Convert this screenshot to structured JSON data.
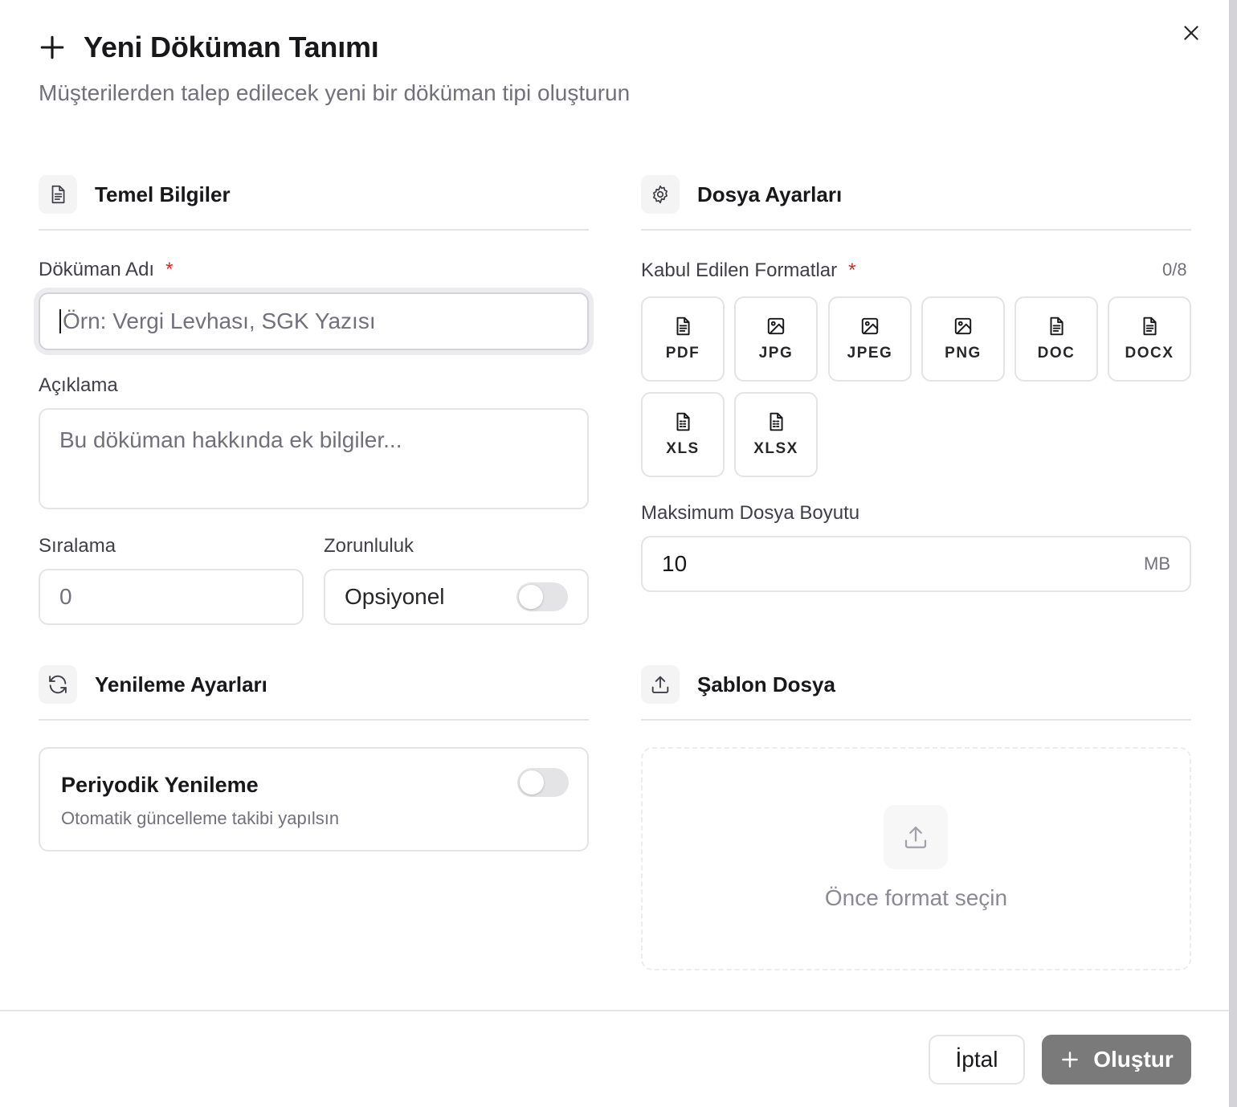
{
  "header": {
    "title": "Yeni Döküman Tanımı",
    "subtitle": "Müşterilerden talep edilecek yeni bir döküman tipi oluşturun"
  },
  "basic_info": {
    "title": "Temel Bilgiler",
    "name_label": "Döküman Adı",
    "required_mark": "*",
    "name_placeholder": "Örn: Vergi Levhası, SGK Yazısı",
    "description_label": "Açıklama",
    "description_placeholder": "Bu döküman hakkında ek bilgiler...",
    "order_label": "Sıralama",
    "order_value": "0",
    "requirement_label": "Zorunluluk",
    "requirement_value": "Opsiyonel"
  },
  "file_settings": {
    "title": "Dosya Ayarları",
    "formats_label": "Kabul Edilen Formatlar",
    "required_mark": "*",
    "formats_counter": "0/8",
    "formats": [
      {
        "label": "PDF",
        "icon": "file-text-icon"
      },
      {
        "label": "JPG",
        "icon": "image-icon"
      },
      {
        "label": "JPEG",
        "icon": "image-icon"
      },
      {
        "label": "PNG",
        "icon": "image-icon"
      },
      {
        "label": "DOC",
        "icon": "file-text-icon"
      },
      {
        "label": "DOCX",
        "icon": "file-text-icon"
      },
      {
        "label": "XLS",
        "icon": "file-spreadsheet-icon"
      },
      {
        "label": "XLSX",
        "icon": "file-spreadsheet-icon"
      }
    ],
    "max_size_label": "Maksimum Dosya Boyutu",
    "max_size_value": "10",
    "max_size_unit": "MB"
  },
  "renewal": {
    "title": "Yenileme Ayarları",
    "periodic_title": "Periyodik Yenileme",
    "periodic_subtitle": "Otomatik güncelleme takibi yapılsın"
  },
  "template": {
    "title": "Şablon Dosya",
    "empty_text": "Önce format seçin"
  },
  "footer": {
    "cancel_label": "İptal",
    "create_label": "Oluştur"
  }
}
